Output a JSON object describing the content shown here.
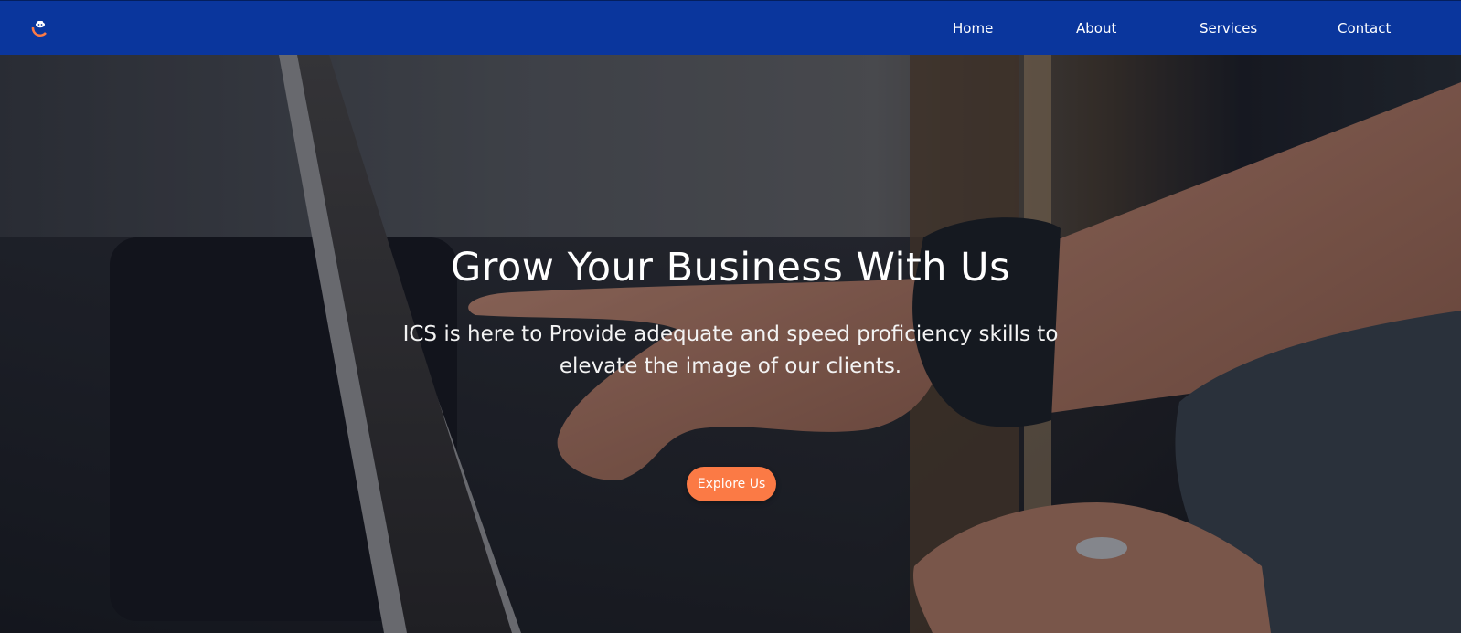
{
  "colors": {
    "navbar_bg": "#0a369d",
    "accent": "#fb7a45",
    "text": "#ffffff"
  },
  "navbar": {
    "logo_icon": "ics-logo-icon",
    "links": [
      {
        "label": "Home"
      },
      {
        "label": "About"
      },
      {
        "label": "Services"
      },
      {
        "label": "Contact"
      }
    ]
  },
  "hero": {
    "background_image": "laptop-smartwatch-hands-photo",
    "title": "Grow Your Business With Us",
    "subtitle": "ICS is here to Provide adequate and speed proficiency skills to elevate the image of our clients.",
    "cta_label": "Explore Us"
  }
}
